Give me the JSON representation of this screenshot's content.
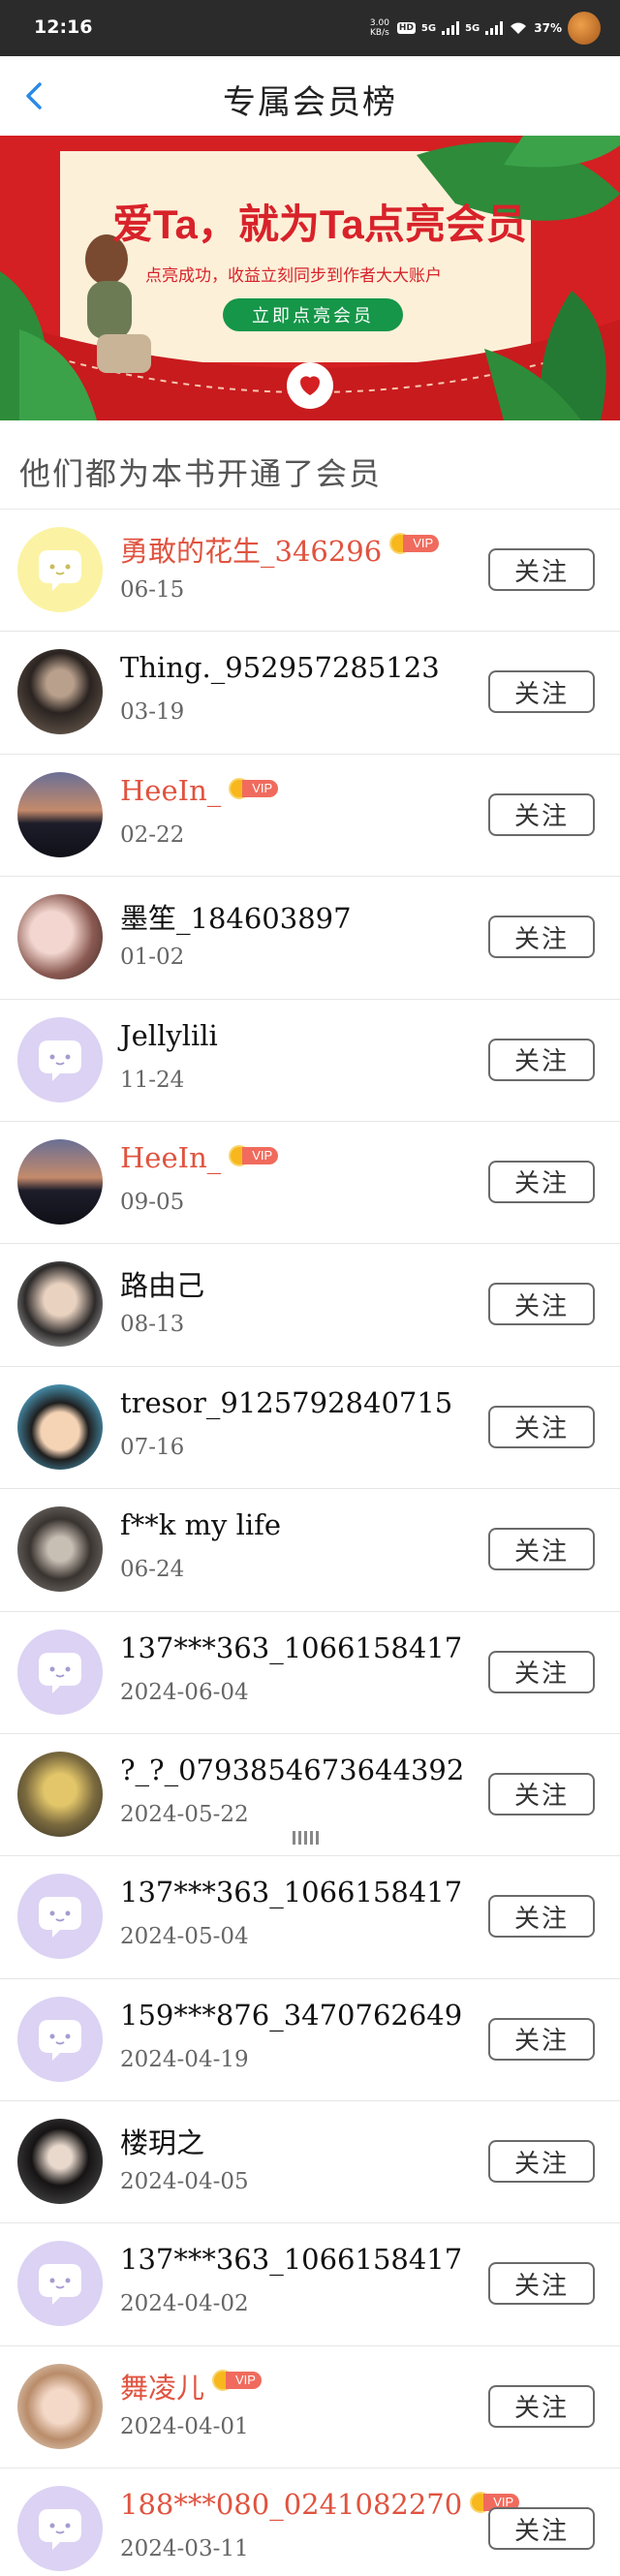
{
  "status_bar": {
    "time": "12:16",
    "net_speed_top": "3.00",
    "net_speed_bottom": "KB/s",
    "hd_label": "HD",
    "sig1_label": "5G",
    "sig2_label": "5G",
    "battery": "37%"
  },
  "nav": {
    "back_icon": "chevron-left-icon",
    "title": "专属会员榜"
  },
  "banner": {
    "title": "爱Ta，就为Ta点亮会员",
    "subtitle": "点亮成功，收益立刻同步到作者大大账户",
    "button": "立即点亮会员"
  },
  "section": {
    "title": "他们都为本书开通了会员"
  },
  "follow_label": "关注",
  "vip_label": "VIP",
  "members": [
    {
      "name": "勇敢的花生_346296",
      "date": "06-15",
      "vip": true,
      "avatar": "default-yellow"
    },
    {
      "name": "Thing._952957285123",
      "date": "03-19",
      "vip": false,
      "avatar": "photo-girl-dark"
    },
    {
      "name": "HeeIn_",
      "date": "02-22",
      "vip": true,
      "avatar": "photo-sunset"
    },
    {
      "name": "墨笙_184603897",
      "date": "01-02",
      "vip": false,
      "avatar": "photo-pink"
    },
    {
      "name": "Jellylili",
      "date": "11-24",
      "vip": false,
      "avatar": "default-purple"
    },
    {
      "name": "HeeIn_",
      "date": "09-05",
      "vip": true,
      "avatar": "photo-sunset"
    },
    {
      "name": "路由己",
      "date": "08-13",
      "vip": false,
      "avatar": "photo-boy"
    },
    {
      "name": "tresor_9125792840715",
      "date": "07-16",
      "vip": false,
      "avatar": "photo-cartoon"
    },
    {
      "name": "f**k my life",
      "date": "06-24",
      "vip": false,
      "avatar": "photo-hood"
    },
    {
      "name": "137***363_1066158417",
      "date": "2024-06-04",
      "vip": false,
      "avatar": "default-purple"
    },
    {
      "name": "?_?_0793854673644392",
      "date": "2024-05-22",
      "vip": false,
      "avatar": "photo-blond"
    },
    {
      "name": "137***363_1066158417",
      "date": "2024-05-04",
      "vip": false,
      "avatar": "default-purple"
    },
    {
      "name": "159***876_3470762649",
      "date": "2024-04-19",
      "vip": false,
      "avatar": "default-purple"
    },
    {
      "name": "楼玥之",
      "date": "2024-04-05",
      "vip": false,
      "avatar": "photo-girl-black"
    },
    {
      "name": "137***363_1066158417",
      "date": "2024-04-02",
      "vip": false,
      "avatar": "default-purple"
    },
    {
      "name": "舞凌儿",
      "date": "2024-04-01",
      "vip": true,
      "avatar": "photo-girl-soft"
    },
    {
      "name": "188***080_0241082270",
      "date": "2024-03-11",
      "vip": true,
      "avatar": "default-purple"
    }
  ],
  "colors": {
    "vip_name": "#e0533f",
    "banner_red": "#d42022",
    "button_green": "#159648",
    "back_blue": "#2a8ae6"
  }
}
